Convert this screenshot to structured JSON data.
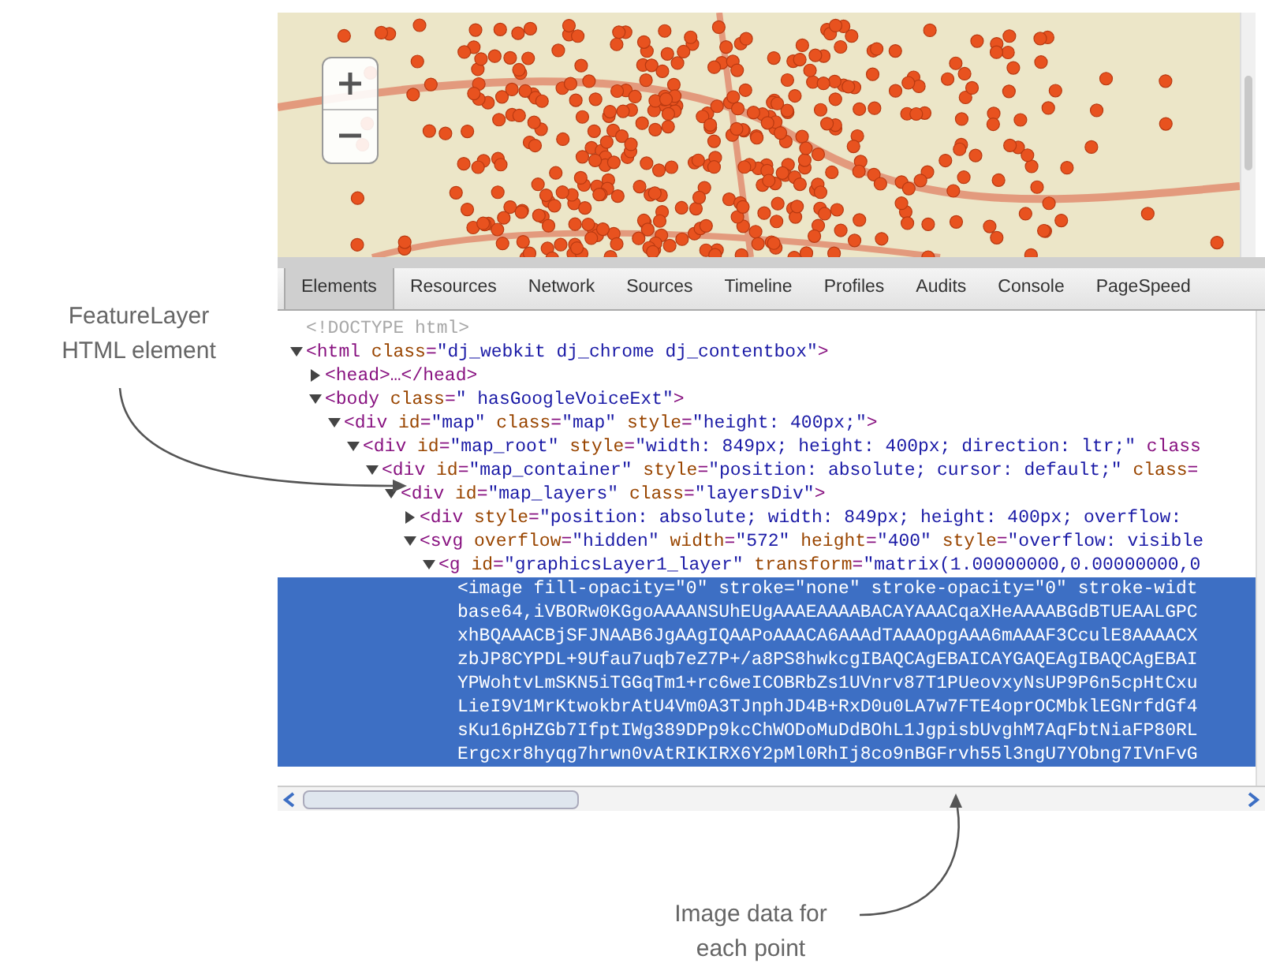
{
  "left_callout": {
    "text": "FeatureLayer HTML element"
  },
  "tabs": [
    {
      "label": "Elements",
      "selected": true
    },
    {
      "label": "Resources",
      "selected": false
    },
    {
      "label": "Network",
      "selected": false
    },
    {
      "label": "Sources",
      "selected": false
    },
    {
      "label": "Timeline",
      "selected": false
    },
    {
      "label": "Profiles",
      "selected": false
    },
    {
      "label": "Audits",
      "selected": false
    },
    {
      "label": "Console",
      "selected": false
    },
    {
      "label": "PageSpeed",
      "selected": false
    }
  ],
  "code": [
    {
      "kind": "doctype",
      "text": "<!DOCTYPE html>",
      "selected": false
    },
    {
      "kind": "element",
      "text": "<html class=\"dj_webkit dj_chrome dj_contentbox\">",
      "expanded": true,
      "selected": false,
      "children": [
        {
          "kind": "element",
          "text": "<head>…</head>",
          "expanded": false,
          "selected": false
        },
        {
          "kind": "element",
          "text": "<body class=\" hasGoogleVoiceExt\">",
          "expanded": true,
          "selected": false,
          "children": [
            {
              "kind": "element",
              "text": "<div id=\"map\" class=\"map\" style=\"height: 400px;\">",
              "expanded": true,
              "selected": false,
              "children": [
                {
                  "kind": "element",
                  "text": "<div id=\"map_root\" style=\"width: 849px; height: 400px; direction: ltr;\" class",
                  "expanded": true,
                  "selected": false,
                  "children": [
                    {
                      "kind": "element",
                      "text": "<div id=\"map_container\" style=\"position: absolute; cursor: default;\" class=",
                      "expanded": true,
                      "selected": false,
                      "children": [
                        {
                          "kind": "element",
                          "text": "<div id=\"map_layers\" class=\"layersDiv\">",
                          "expanded": true,
                          "selected": false,
                          "children": [
                            {
                              "kind": "element",
                              "text": "<div style=\"position: absolute; width: 849px; height: 400px; overflow:",
                              "expanded": false,
                              "selected": false
                            },
                            {
                              "kind": "element",
                              "text": "<svg overflow=\"hidden\" width=\"572\" height=\"400\" style=\"overflow: visible",
                              "expanded": true,
                              "selected": false,
                              "children": [
                                {
                                  "kind": "element",
                                  "text": "<g id=\"graphicsLayer1_layer\" transform=\"matrix(1.00000000,0.00000000,0",
                                  "expanded": true,
                                  "selected": false,
                                  "children": [
                                    {
                                      "kind": "element",
                                      "text": "<image fill-opacity=\"0\" stroke=\"none\" stroke-opacity=\"0\" stroke-widt",
                                      "selected": true,
                                      "continuation_lines": [
                                        "base64,iVBORw0KGgoAAAANSUhEUgAAAEAAAABACAYAAACqaXHeAAAABGdBTUEAALGPC",
                                        "xhBQAAACBjSFJNAAB6JgAAgIQAAPoAAACA6AAAdTAAAOpgAAA6mAAAF3CculE8AAAACX",
                                        "zbJP8CYPDL+9Ufau7uqb7eZ7P+/a8PS8hwkcgIBAQCAgEBAICAYGAQEAgIBAQCAgEBAI",
                                        "YPWohtvLmSKN5iTGGqTm1+rc6weICOBRbZs1UVnrv87T1PUeovxyNsUP9P6n5cpHtCxu",
                                        "LieI9V1MrKtwokbrAtU4Vm0A3TJnphJD4B+RxD0u0LA7w7FTE4oprOCMbklEGNrfdGf4",
                                        "sKu16pHZGb7IfptIWg389DPp9kcChWODoMuDdBOhL1JgpisbUvghM7AqFbtNiaFP80RL",
                                        "Ergcxr8hyqg7hrwn0vAtRIKIRX6Y2pMl0RhIj8co9nBGFrvh55l3ngU7YObng7IVnFvG"
                                      ]
                                    }
                                  ]
                                }
                              ]
                            }
                          ]
                        }
                      ]
                    }
                  ]
                }
              ]
            }
          ]
        }
      ]
    }
  ],
  "bottom_callout": {
    "text": "Image data for each point"
  }
}
